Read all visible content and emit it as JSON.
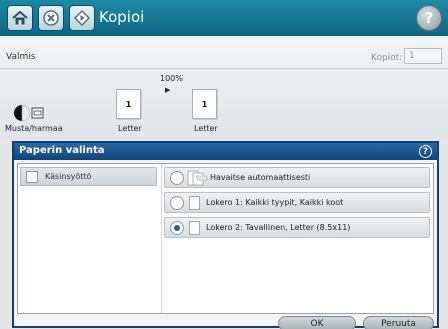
{
  "app": {
    "title": "Kopioi"
  },
  "topbar": {
    "home_icon": "home-icon",
    "stop_icon": "stop-icon",
    "start_icon": "start-icon",
    "help_icon": "help-icon",
    "help_glyph": "?"
  },
  "status": {
    "text": "Valmis",
    "copies_label": "Kopiot:",
    "copies_value": "1"
  },
  "preview": {
    "mode_label": "Musta/harmaa",
    "zoom": "100%",
    "original_count": "1",
    "original_label": "Letter",
    "copy_count": "1",
    "copy_label": "Letter"
  },
  "dialog": {
    "title": "Paperin valinta",
    "help_glyph": "?",
    "left_item_label": "Käsinsyöttö",
    "options": [
      {
        "label": "Havaitse automaattisesti",
        "selected": false
      },
      {
        "label": "Lokero 1: Kaikki tyypit, Kaikki koot",
        "selected": false
      },
      {
        "label": "Lokero 2: Tavallinen, Letter (8.5x11)",
        "selected": true
      }
    ],
    "ok_label": "OK",
    "cancel_label": "Peruuta"
  },
  "colors": {
    "topbar": "#1e8aa6",
    "dialog_header": "#2a67a3",
    "radio_selected": "#1f5ea6"
  }
}
